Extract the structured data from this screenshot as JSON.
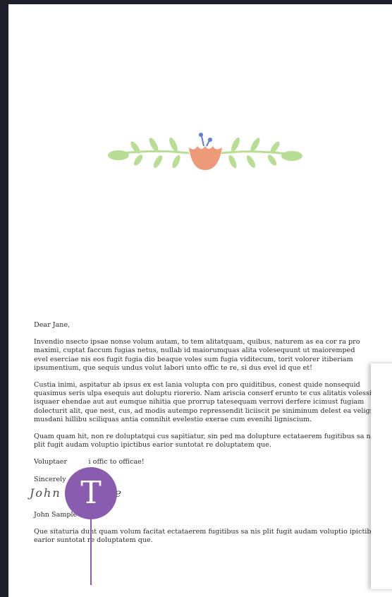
{
  "letter": {
    "greeting": "Dear Jane,",
    "paragraph1": [
      "Invendio nsecto ipsae nonse volum autam, to tem alitatquam, quibus, naturem as ea cor ra pro",
      "maximi, cuptat faccum fugias netus, nullab id maiorumquas alita volesequunt ut maioremped",
      "evel eserciae nis eos fugit fugia dio beaque voles sum fugia viditecum, torit volorer itiberiam",
      "ipsumentium, que sequis undus volut labori unto offic te re, si dus evel id que et!"
    ],
    "paragraph2": [
      "Custia inimi, aspitatur ab ipsus ex est lania volupta con pro quiditibus, conest quide nonsequid",
      "quasimus seris ulpa esequis aut doluptu riorerio. Nam ariscia conserf erunto te cus alitatis volessit",
      "isquaer ehendae aut aut eumque nihitia que prorrup tatesequam verrovi derfere icimust fugiam",
      "dolecturit alit, que nest, cus, ad modis autempo repressendit liciiscit pe siniminum delest ea velign",
      "musdani hillibu sciliquas antia comnihit evelestio exerae cum evenihi ligniscium."
    ],
    "paragraph3": [
      "Quam quam hit, non re doluptatqui cus sapitiatur, sin ped ma dolupture ectataerem fugitibus sa nis",
      "plit fugit audam voluptio ipictibus earior suntotat re doluptatem que."
    ],
    "paragraph4": "Voluptaer          i offic to officae!",
    "closing": "Sincerely",
    "signature_script": "John        ple",
    "name": "John Sample",
    "postscript": [
      "Que sitaturia dunt quam volum facitat ectataerem fugitibus sa nis plit fugit audam voluptio ipictibu",
      "earior suntotat re doluptatem que."
    ]
  },
  "text_tool_marker": {
    "glyph": "T"
  },
  "colors": {
    "background": "#1f1f2b",
    "page": "#ffffff",
    "marker": "#8a5cb0",
    "leaf": "#b8dd94",
    "flower": "#ee9a79",
    "stamen": "#5d7fd6"
  },
  "icons": {
    "decoration": "floral-vine-icon",
    "marker": "text-tool-icon"
  }
}
